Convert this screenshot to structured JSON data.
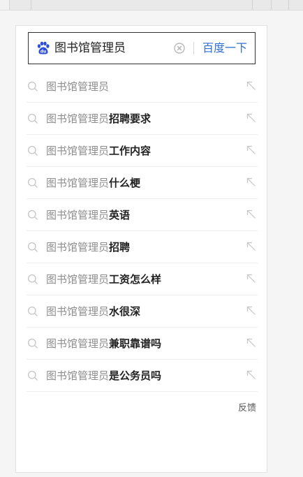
{
  "search": {
    "query": "图书馆管理员",
    "submit_label": "百度一下"
  },
  "suggestions": [
    {
      "base": "图书馆管理员",
      "suffix": ""
    },
    {
      "base": "图书馆管理员",
      "suffix": "招聘要求"
    },
    {
      "base": "图书馆管理员",
      "suffix": "工作内容"
    },
    {
      "base": "图书馆管理员",
      "suffix": "什么梗"
    },
    {
      "base": "图书馆管理员",
      "suffix": "英语"
    },
    {
      "base": "图书馆管理员",
      "suffix": "招聘"
    },
    {
      "base": "图书馆管理员",
      "suffix": "工资怎么样"
    },
    {
      "base": "图书馆管理员",
      "suffix": "水很深"
    },
    {
      "base": "图书馆管理员",
      "suffix": "兼职靠谱吗"
    },
    {
      "base": "图书馆管理员",
      "suffix": "是公务员吗"
    }
  ],
  "feedback_label": "反馈",
  "icons": {
    "logo": "baidu-paw-icon",
    "clear": "clear-circle-x-icon",
    "suggestion": "magnifier-icon",
    "fill": "arrow-up-left-icon"
  },
  "colors": {
    "brand_blue": "#2e6fd6",
    "text_dark": "#222222",
    "text_gray": "#8e8e8e",
    "border_dark": "#333333"
  }
}
